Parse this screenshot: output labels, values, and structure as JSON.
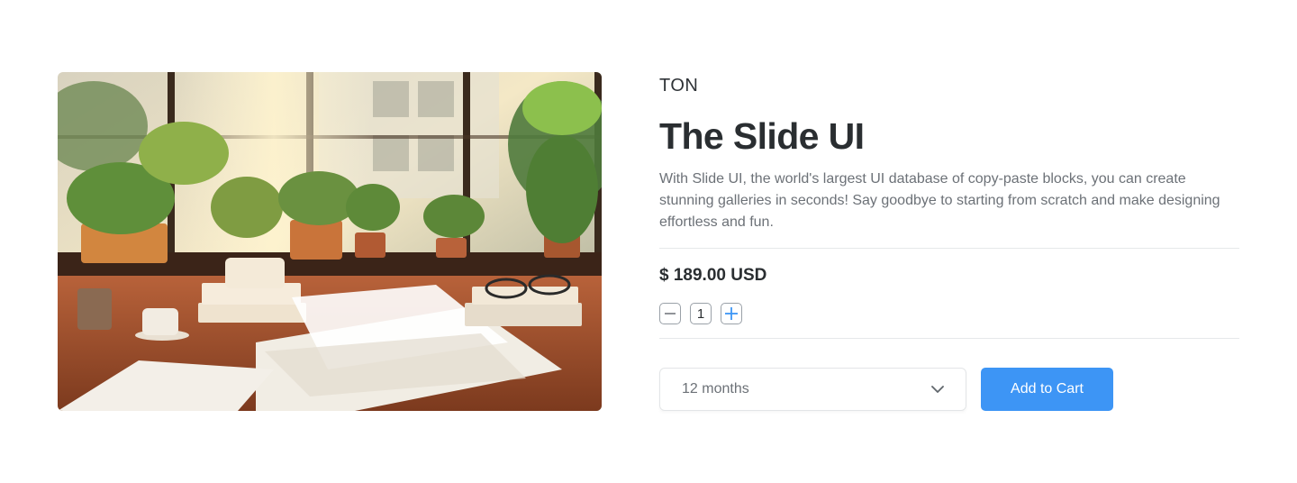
{
  "product": {
    "brand": "TON",
    "title": "The Slide UI",
    "description": "With Slide UI, the world's largest UI database of copy-paste blocks, you can create stunning galleries in seconds! Say goodbye to starting from scratch and make designing effortless and fun.",
    "price": "$ 189.00 USD",
    "image_icon": "product-photo-desk-plants"
  },
  "quantity": {
    "value": "1",
    "decrement_icon": "minus-icon",
    "increment_icon": "plus-icon"
  },
  "plan_select": {
    "selected": "12 months",
    "icon": "chevron-down-icon"
  },
  "cart": {
    "label": "Add to Cart",
    "color": "#3d95f5"
  },
  "colors": {
    "accent": "#3d95f5",
    "text_primary": "#2a2e31",
    "text_muted": "#6c7177"
  }
}
